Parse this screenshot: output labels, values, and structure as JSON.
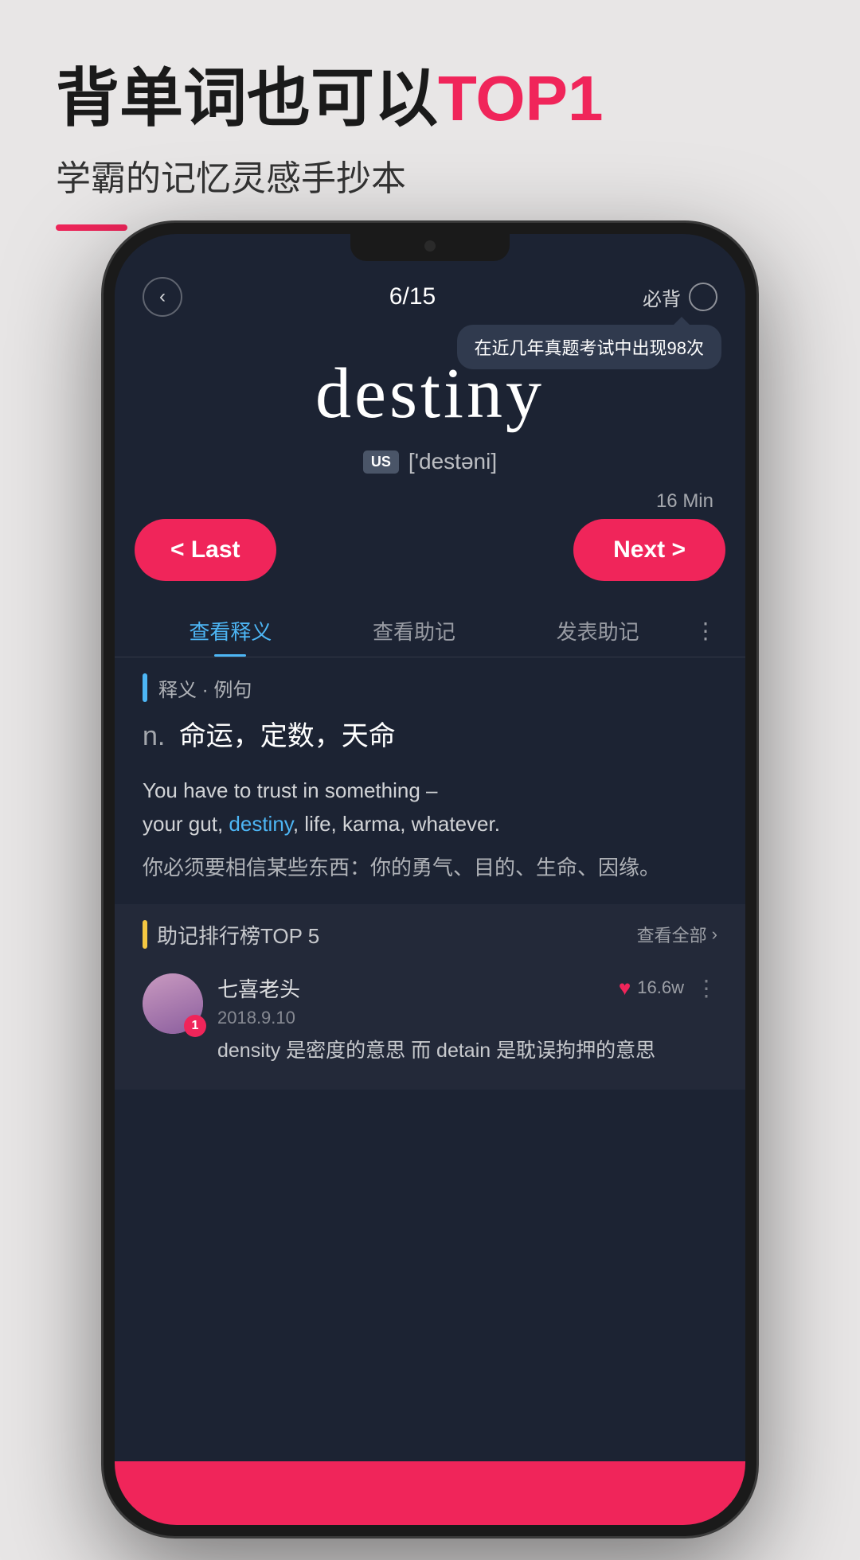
{
  "header": {
    "main_title_part1": "背单词也可以",
    "main_title_highlight": "TOP1",
    "sub_title": "学霸的记忆灵感手抄本"
  },
  "phone": {
    "nav": {
      "back_label": "‹",
      "page_counter": "6/15",
      "must_learn_label": "必背"
    },
    "tooltip": {
      "text": "在近几年真题考试中出现98次"
    },
    "word": {
      "english": "destiny",
      "us_badge": "US",
      "phonetic": "['destəni]"
    },
    "timer": {
      "label": "16 Min"
    },
    "nav_buttons": {
      "last_label": "< Last",
      "next_label": "Next >"
    },
    "tabs": [
      {
        "label": "查看释义",
        "active": true
      },
      {
        "label": "查看助记",
        "active": false
      },
      {
        "label": "发表助记",
        "active": false
      }
    ],
    "definition": {
      "section_title": "释义 · 例句",
      "pos": "n.",
      "meaning": "命运，定数，天命",
      "example_en_1": "You have to trust in something –",
      "example_en_2": "your gut, ",
      "example_en_word": "destiny",
      "example_en_3": ", life, karma, whatever.",
      "example_zh": "你必须要相信某些东西：你的勇气、目的、生命、因缘。"
    },
    "mnemonic": {
      "section_title": "助记排行榜TOP 5",
      "view_all_label": "查看全部",
      "user": {
        "name": "七喜老头",
        "date": "2018.9.10",
        "rank": "1",
        "like_count": "16.6w",
        "text": "density 是密度的意思 而 detain 是耽误拘押的意思"
      }
    }
  }
}
